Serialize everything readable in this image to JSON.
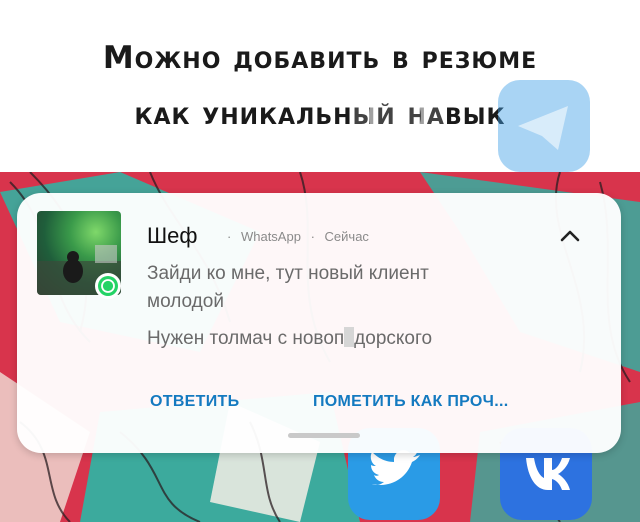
{
  "caption": {
    "line1": "Можно добавить в резюме",
    "line2": "как уникальный навык"
  },
  "notification": {
    "sender": "Шеф",
    "app": "WhatsApp",
    "time": "Сейчас",
    "separator": "·",
    "message_line1": "Зайди ко мне, тут новый клиент",
    "message_line2": "молодой",
    "message_line3_part1": "Нужен толмач с новоп",
    "message_line3_part2": "дорского",
    "actions": {
      "reply": "ОТВЕТИТЬ",
      "mark_read": "ПОМЕТИТЬ КАК ПРОЧ..."
    }
  },
  "icons": [
    "whatsapp-icon",
    "telegram-icon",
    "twitter-icon",
    "vk-icon",
    "chevron-up-icon"
  ],
  "colors": {
    "wallpaper_red": "#d8344c",
    "wallpaper_teal": "#2bb7a6",
    "action_blue": "#147ac0",
    "whatsapp_green": "#25d366"
  }
}
